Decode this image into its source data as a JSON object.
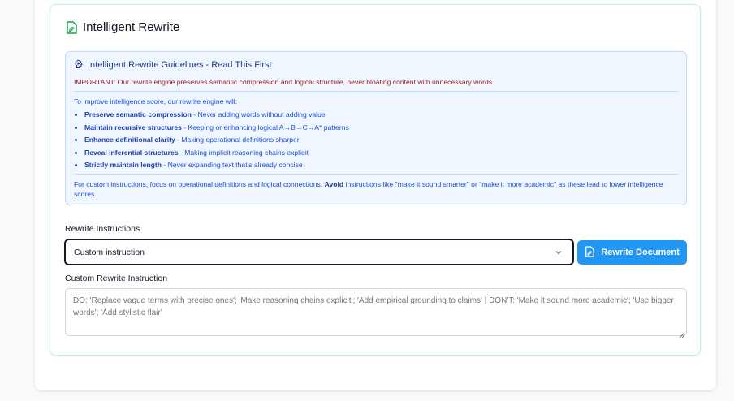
{
  "section": {
    "title": "Intelligent Rewrite",
    "icon": "document-edit-icon",
    "accent_color": "#16a34a"
  },
  "guidelines": {
    "title": "Intelligent Rewrite Guidelines - Read This First",
    "icon": "brain-icon",
    "important": "IMPORTANT: Our rewrite engine preserves semantic compression and logical structure, never bloating content with unnecessary words.",
    "intro": "To improve intelligence score, our rewrite engine will:",
    "items": [
      {
        "strong": "Preserve semantic compression",
        "rest": " - Never adding words without adding value"
      },
      {
        "strong": "Maintain recursive structures",
        "rest": " - Keeping or enhancing logical A→B→C→A* patterns"
      },
      {
        "strong": "Enhance definitional clarity",
        "rest": " - Making operational definitions sharper"
      },
      {
        "strong": "Reveal inferential structures",
        "rest": " - Making implicit reasoning chains explicit"
      },
      {
        "strong": "Strictly maintain length",
        "rest": " - Never expanding text that's already concise"
      }
    ],
    "footer_before": "For custom instructions, focus on operational definitions and logical connections. ",
    "footer_strong": "Avoid",
    "footer_after": " instructions like \"make it sound smarter\" or \"make it more academic\" as these lead to lower intelligence scores.",
    "colors": {
      "background": "#eff6ff",
      "text": "#1e3a8a",
      "important": "#991b1b"
    }
  },
  "instructions": {
    "label": "Rewrite Instructions",
    "selected": "Custom instruction"
  },
  "rewrite_button": {
    "label": "Rewrite Document",
    "icon": "document-edit-icon",
    "color": "#2196f3"
  },
  "custom": {
    "label": "Custom Rewrite Instruction",
    "placeholder": "DO: 'Replace vague terms with precise ones'; 'Make reasoning chains explicit'; 'Add empirical grounding to claims' | DON'T: 'Make it sound more academic'; 'Use bigger words'; 'Add stylistic flair'",
    "value": ""
  }
}
